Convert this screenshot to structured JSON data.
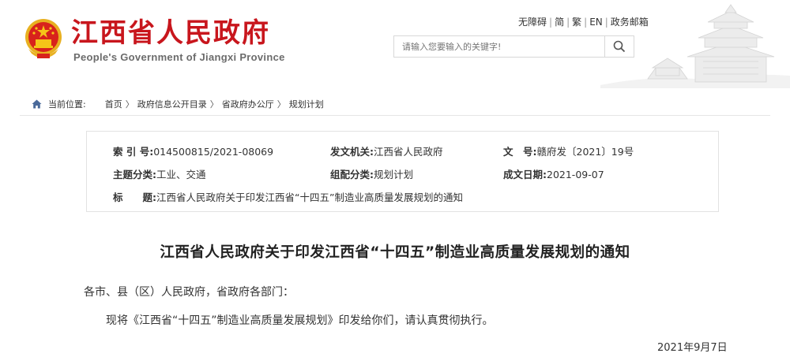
{
  "header": {
    "site_name": "江西省人民政府",
    "site_name_en": "People's Government of Jiangxi Province",
    "links": [
      "无障碍",
      "简",
      "繁",
      "EN",
      "政务邮箱"
    ],
    "search_placeholder": "请输入您要输入的关键字!"
  },
  "breadcrumb": {
    "label": "当前位置:",
    "items": [
      "首页",
      "政府信息公开目录",
      "省政府办公厅",
      "规划计划"
    ]
  },
  "info": {
    "index_label": "索 引 号:",
    "index_value": "014500815/2021-08069",
    "org_label": "发文机关:",
    "org_value": "江西省人民政府",
    "docno_label": "文　号:",
    "docno_value": "赣府发〔2021〕19号",
    "topic_label": "主题分类:",
    "topic_value": "工业、交通",
    "category_label": "组配分类:",
    "category_value": "规划计划",
    "date_label": "成文日期:",
    "date_value": "2021-09-07",
    "title_label": "标　　题:",
    "title_value": "江西省人民政府关于印发江西省“十四五”制造业高质量发展规划的通知"
  },
  "article": {
    "title": "江西省人民政府关于印发江西省“十四五”制造业高质量发展规划的通知",
    "salutation": "各市、县（区）人民政府，省政府各部门：",
    "body": "现将《江西省“十四五”制造业高质量发展规划》印发给你们，请认真贯彻执行。",
    "date": "2021年9月7日"
  },
  "colors": {
    "brand_red": "#c8161d",
    "emblem_gold": "#e8b020"
  }
}
